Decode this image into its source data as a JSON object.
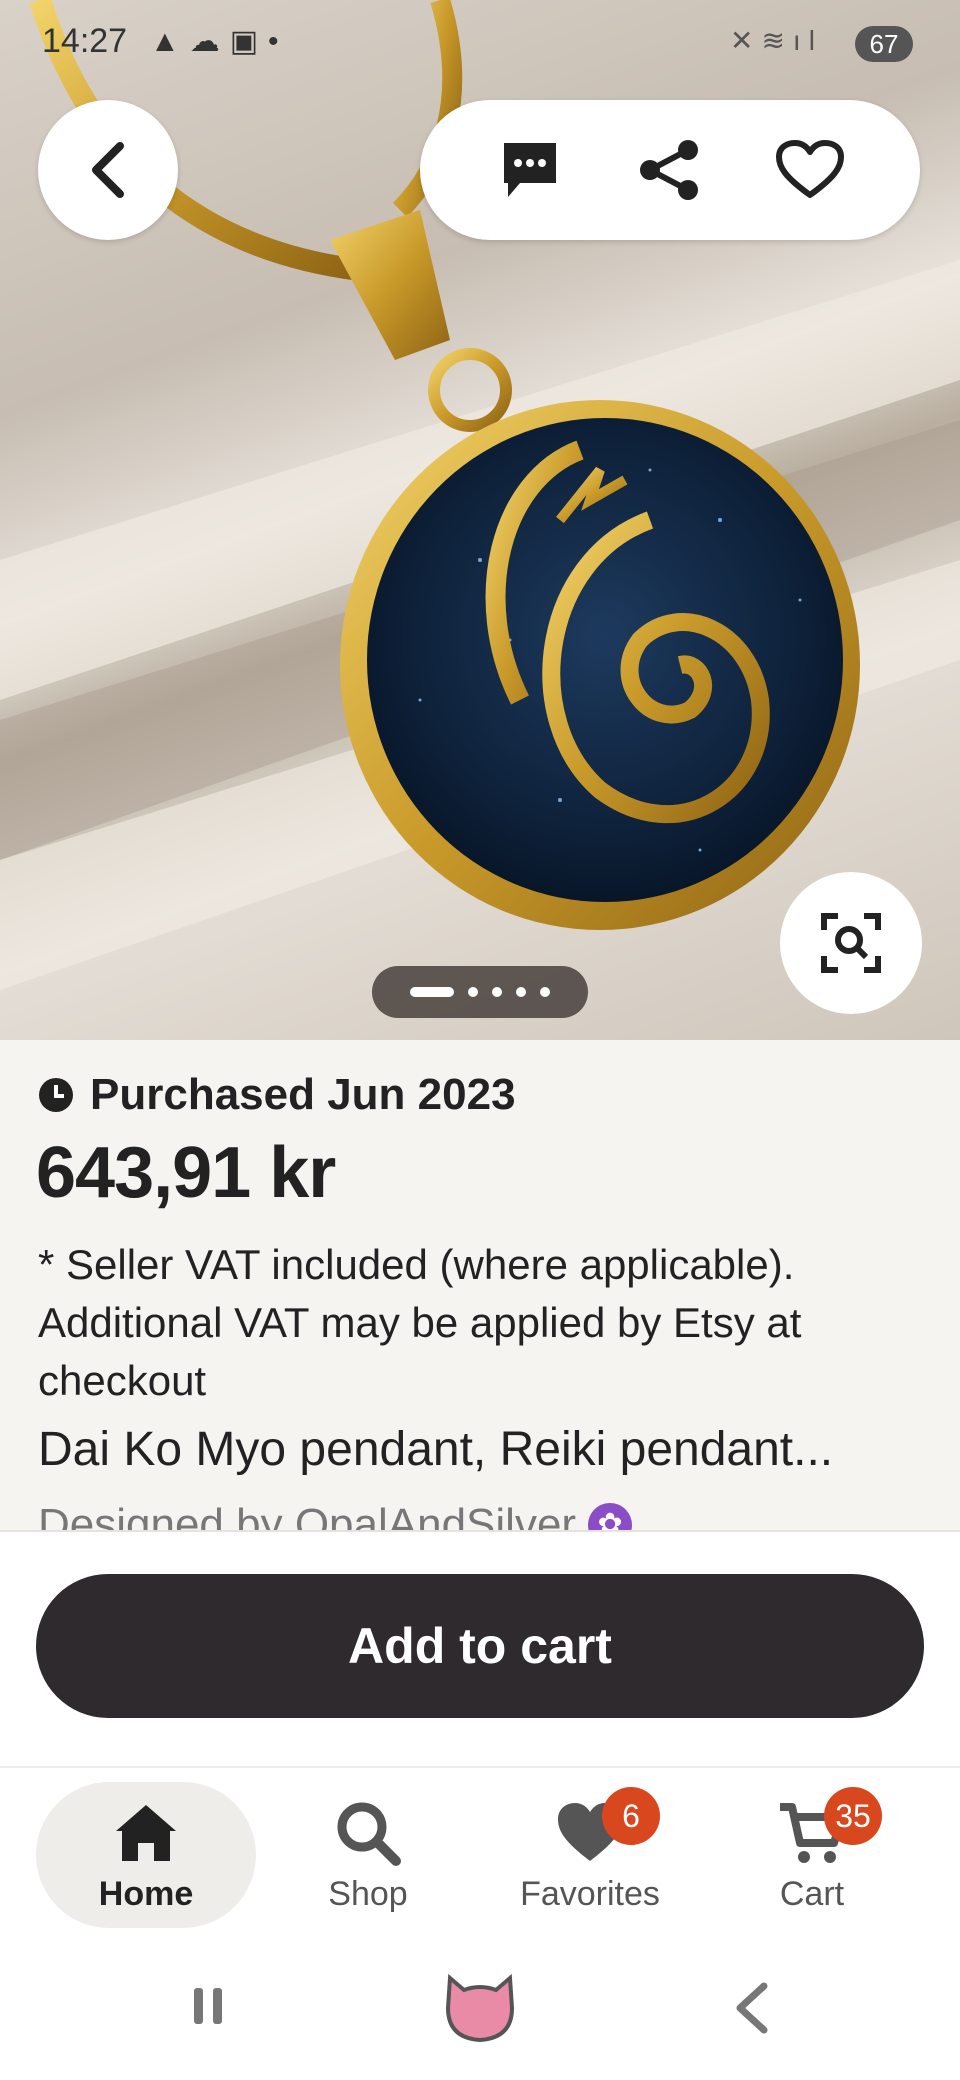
{
  "status_bar": {
    "time": "14:27",
    "battery": "67"
  },
  "top_actions": {
    "back": "back-icon",
    "message": "message-icon",
    "share": "share-icon",
    "favorite": "heart-icon"
  },
  "gallery": {
    "page_count": 5,
    "current_page": 1
  },
  "listing": {
    "purchased": "Purchased Jun 2023",
    "price": "643,91 kr",
    "vat_note": "* Seller VAT included (where applicable). Additional VAT may be applied by Etsy at checkout",
    "title": "Dai Ko Myo pendant, Reiki pendant...",
    "designed_by": "Designed by OpalAndSilver"
  },
  "cart_bar": {
    "add_to_cart": "Add to cart"
  },
  "bottom_nav": {
    "items": [
      {
        "label": "Home",
        "icon": "home-icon"
      },
      {
        "label": "Shop",
        "icon": "search-icon"
      },
      {
        "label": "Favorites",
        "icon": "heart-icon",
        "badge": "6"
      },
      {
        "label": "Cart",
        "icon": "cart-icon",
        "badge": "35"
      }
    ]
  },
  "colors": {
    "accent_dark": "#2e2a2e",
    "badge": "#d8471d",
    "star_seller": "#8b4cc8"
  }
}
